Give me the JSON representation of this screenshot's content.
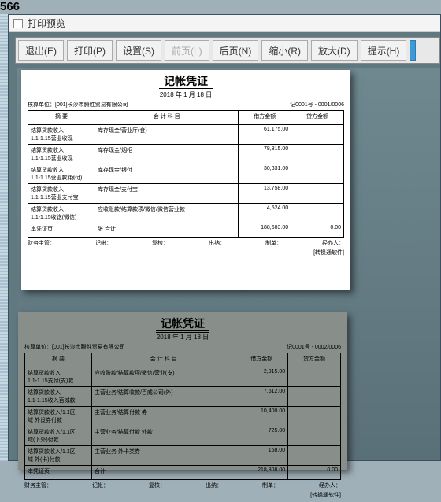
{
  "page_corner": "566",
  "window": {
    "title": "打印预览"
  },
  "toolbar": {
    "exit": "退出(E)",
    "print": "打印(P)",
    "setup": "设置(S)",
    "prev": "前页(L)",
    "next": "后页(N)",
    "zoomout": "缩小(R)",
    "zoomin": "放大(D)",
    "hint": "提示(H)"
  },
  "voucher1": {
    "title": "记帐凭证",
    "date": "2018 年 1 月 18 日",
    "unit": "核算单位：[001]长沙市腾胜贸易有限公司",
    "pageno": "记0001号 - 0001/0006",
    "headers": {
      "summary": "摘    要",
      "account": "会  计  科  目",
      "debit": "借方金额",
      "credit": "贷方金额"
    },
    "rows": [
      {
        "s": "结算货款收入\n1.1-1.15营业收现",
        "a": "库存现金/营业厅(食)",
        "d": "61,175.00",
        "c": ""
      },
      {
        "s": "结算货款收入\n1.1-1.15营业收现",
        "a": "库存现金/烟柜",
        "d": "78,815.00",
        "c": ""
      },
      {
        "s": "结算货款收入\n1.1-1.15营业款(银付)",
        "a": "库存现金/银付",
        "d": "30,331.00",
        "c": ""
      },
      {
        "s": "结算货款收入\n1.1-1.15营业支付宝",
        "a": "库存现金/支付宝",
        "d": "13,758.00",
        "c": ""
      },
      {
        "s": "结算货款收入\n1.1-1.15收讫(微信)",
        "a": "应收账款/结算款项/微信/微信营业款",
        "d": "4,524.00",
        "c": ""
      }
    ],
    "total": {
      "s": "本凭证页",
      "a2": "张    合计",
      "d": "188,603.00",
      "c": "0.00"
    },
    "foot": {
      "a": "财务主管：",
      "b": "记帐：",
      "c": "复核：",
      "d": "出纳：",
      "e": "制单：",
      "f": "经办人："
    },
    "stamp": "[转换通软件]"
  },
  "voucher2": {
    "title": "记帐凭证",
    "date": "2018 年 1 月 18 日",
    "unit": "核算单位：[001]长沙市腾胜贸易有限公司",
    "pageno": "记0001号 - 0002/0006",
    "headers": {
      "summary": "摘    要",
      "account": "会  计  科  目",
      "debit": "借方金额",
      "credit": "贷方金额"
    },
    "rows": [
      {
        "s": "结算货款收入\n1.1-1.15支付(支)款",
        "a": "应收账款/结算款项/微信/营业(支)",
        "d": "2,915.00",
        "c": ""
      },
      {
        "s": "结算货款收入\n1.1-1.15收入百威款",
        "a": "主营业务/结算收款/百威公司(外)",
        "d": "7,612.00",
        "c": ""
      },
      {
        "s": "结算货款收入/1.1区\n域 外设券付款",
        "a": "主营业务/结算付款  券",
        "d": "10,400.00",
        "c": ""
      },
      {
        "s": "结算货款收入/1.1区\n域(下外)付款",
        "a": "主营业务/结算付款  外款",
        "d": "725.00",
        "c": ""
      },
      {
        "s": "结算货款收入/1.1区\n域 外(卡)付款",
        "a": "主营业务  外卡类券",
        "d": "158.00",
        "c": ""
      }
    ],
    "total": {
      "s": "本凭证页",
      "a2": "合计",
      "d": "218,808.00",
      "c": "0.00"
    },
    "foot": {
      "a": "财务主管：",
      "b": "记帐：",
      "c": "复核：",
      "d": "出纳：",
      "e": "制单：",
      "f": "经办人："
    },
    "stamp": "[转换通软件]"
  }
}
